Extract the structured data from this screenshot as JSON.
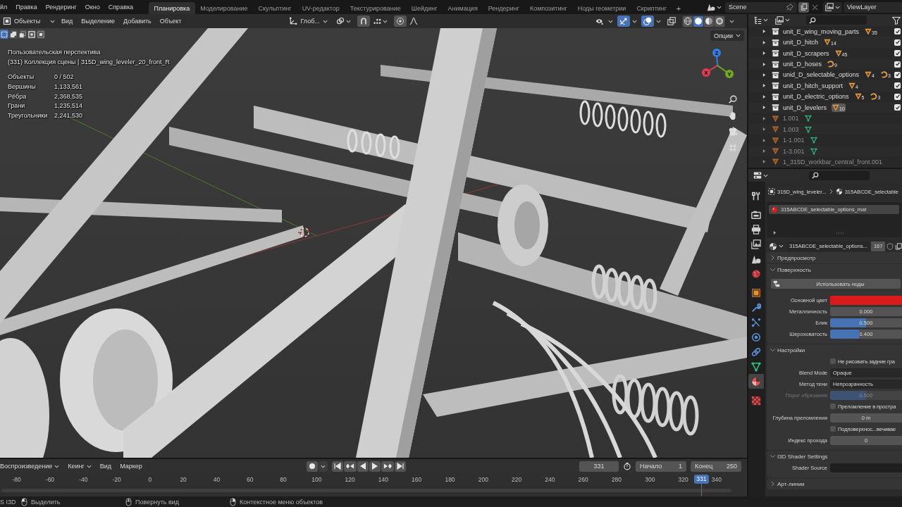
{
  "topbar": {
    "menus": [
      "йл",
      "Правка",
      "Рендеринг",
      "Окно",
      "Справка"
    ],
    "workspaces": [
      {
        "label": "Планировка",
        "selected": true
      },
      {
        "label": "Моделирование",
        "selected": false
      },
      {
        "label": "Скульптинг",
        "selected": false
      },
      {
        "label": "UV-редактор",
        "selected": false
      },
      {
        "label": "Текстурирование",
        "selected": false
      },
      {
        "label": "Шейдинг",
        "selected": false
      },
      {
        "label": "Анимация",
        "selected": false
      },
      {
        "label": "Рендеринг",
        "selected": false
      },
      {
        "label": "Композитинг",
        "selected": false
      },
      {
        "label": "Ноды геометрии",
        "selected": false
      },
      {
        "label": "Скриптинг",
        "selected": false
      }
    ],
    "add_workspace": "+",
    "scene": "Scene",
    "view_layer": "ViewLayer"
  },
  "viewport": {
    "mode": "Объекты",
    "menus": [
      "Вид",
      "Выделение",
      "Добавить",
      "Объект"
    ],
    "orientation": "Глоб...",
    "select_modes": [
      {
        "selected": true
      },
      {
        "selected": false
      },
      {
        "selected": false
      },
      {
        "selected": false
      },
      {
        "selected": false
      }
    ],
    "toggles": [
      {
        "kind": "visibility",
        "on": false
      },
      {
        "kind": "gizmo",
        "on": true
      },
      {
        "kind": "overlay",
        "on": true
      },
      {
        "kind": "xray",
        "on": false
      }
    ],
    "shading": [
      {
        "kind": "wireframe",
        "selected": false
      },
      {
        "kind": "solid",
        "selected": true
      },
      {
        "kind": "material",
        "selected": false
      },
      {
        "kind": "rendered",
        "selected": false
      }
    ],
    "options": "Опции",
    "view_name": "Пользовательская перспектива",
    "context": "(331) Коллекция сцены | 315D_wing_leveler_20_front_R",
    "stats": [
      {
        "label": "Объекты",
        "value": "0 / 502"
      },
      {
        "label": "Вершины",
        "value": "1,133,561"
      },
      {
        "label": "Рёбра",
        "value": "2,368,535"
      },
      {
        "label": "Грани",
        "value": "1,235,514"
      },
      {
        "label": "Треугольники",
        "value": "2,241,530"
      }
    ],
    "gizmo": [
      {
        "axis": "Z",
        "color": "#2f7fe0"
      },
      {
        "axis": "X",
        "color": "#e23b52"
      },
      {
        "axis": "Y",
        "color": "#72a91f"
      }
    ]
  },
  "timeline": {
    "menus": [
      {
        "label": "Воспроизведение",
        "dropdown": true
      },
      {
        "label": "Кеинг",
        "dropdown": true
      },
      {
        "label": "Вид",
        "dropdown": false
      },
      {
        "label": "Маркер",
        "dropdown": false
      }
    ],
    "current_frame": "331",
    "start_label": "Начало",
    "start": "1",
    "end_label": "Конец",
    "end": "250",
    "ticks": [
      "-80",
      "-60",
      "-40",
      "-20",
      "0",
      "20",
      "40",
      "60",
      "80",
      "100",
      "120",
      "140",
      "160",
      "180",
      "200",
      "220",
      "240",
      "260",
      "280",
      "300",
      "320",
      "340"
    ],
    "playhead": {
      "frame": "331",
      "level": 0.939
    }
  },
  "outliner": {
    "rows": [
      {
        "kind": "collection",
        "name": "unit_E_wing_moving_parts",
        "checked": true,
        "badges": [
          {
            "kind": "mesh",
            "count": "35",
            "active": false
          }
        ]
      },
      {
        "kind": "collection",
        "name": "unit_D_hitch",
        "checked": true,
        "badges": [
          {
            "kind": "mesh",
            "count": "14",
            "active": false
          }
        ]
      },
      {
        "kind": "collection",
        "name": "unit_D_scrapers",
        "checked": true,
        "badges": [
          {
            "kind": "mesh",
            "count": "45",
            "active": false
          }
        ]
      },
      {
        "kind": "collection",
        "name": "unit_D_hoses",
        "checked": true,
        "badges": [
          {
            "kind": "curve",
            "count": "9",
            "active": false
          }
        ]
      },
      {
        "kind": "collection",
        "name": "unid_D_selectable_options",
        "checked": true,
        "badges": [
          {
            "kind": "mesh",
            "count": "4",
            "active": false
          },
          {
            "kind": "curve",
            "count": "3",
            "active": false
          }
        ]
      },
      {
        "kind": "collection",
        "name": "unit_D_hitch_support",
        "checked": true,
        "badges": [
          {
            "kind": "mesh",
            "count": "4",
            "active": false
          }
        ]
      },
      {
        "kind": "collection",
        "name": "unit_D_electric_options",
        "checked": true,
        "badges": [
          {
            "kind": "mesh",
            "count": "5",
            "active": false
          },
          {
            "kind": "curve",
            "count": "3",
            "active": false
          }
        ]
      },
      {
        "kind": "collection",
        "name": "unit_D_levelers",
        "checked": true,
        "badges": [
          {
            "kind": "mesh",
            "count": "10",
            "active": true
          }
        ]
      },
      {
        "kind": "object",
        "name": "1.001",
        "badges": [
          {
            "kind": "mesh_data",
            "active": false
          }
        ]
      },
      {
        "kind": "object",
        "name": "1.003",
        "badges": [
          {
            "kind": "mesh_data",
            "active": false
          }
        ]
      },
      {
        "kind": "object",
        "name": "1-1.001",
        "badges": [
          {
            "kind": "mesh_data",
            "active": false
          }
        ]
      },
      {
        "kind": "object",
        "name": "1-3.001",
        "badges": [
          {
            "kind": "mesh_data",
            "active": false
          }
        ]
      },
      {
        "kind": "object",
        "name": "1_315D_workbar_central_front.001"
      }
    ]
  },
  "properties": {
    "tabs": [
      {
        "kind": "tool",
        "selected": false
      },
      {
        "kind": "render",
        "selected": false
      },
      {
        "kind": "output",
        "selected": false
      },
      {
        "kind": "view_layer",
        "selected": false
      },
      {
        "kind": "scene",
        "selected": false
      },
      {
        "kind": "world",
        "selected": false
      },
      {
        "kind": "object",
        "selected": false
      },
      {
        "kind": "modifiers",
        "selected": false
      },
      {
        "kind": "particles",
        "selected": false
      },
      {
        "kind": "physics",
        "selected": false
      },
      {
        "kind": "constraints",
        "selected": false
      },
      {
        "kind": "data",
        "selected": false
      },
      {
        "kind": "material",
        "selected": true
      },
      {
        "kind": "texture",
        "selected": false
      }
    ],
    "breadcrumb": [
      "315D_wing_leveler...",
      "315ABCDE_selectable"
    ],
    "slots": [
      {
        "name": "315ABCDE_selectable_options_mat",
        "selected": true
      }
    ],
    "material": {
      "name": "315ABCDE_selectable_options...",
      "users": "167"
    },
    "panels": [
      {
        "title": "Предпросмотр",
        "expanded": false
      },
      {
        "title": "Поверхность",
        "expanded": true,
        "rows": [
          {
            "kind": "button",
            "label": "Использовать ноды"
          },
          {
            "kind": "color",
            "label": "Основной цвет",
            "color": "#d81c1c"
          },
          {
            "kind": "slider",
            "label": "Металличность",
            "value": "0.000",
            "disabled": false
          },
          {
            "kind": "slider",
            "label": "Блик",
            "value": "0.500",
            "level": 0.5,
            "disabled": false
          },
          {
            "kind": "slider",
            "label": "Шероховатость",
            "value": "0.400",
            "level": 0.4,
            "disabled": false
          }
        ]
      },
      {
        "title": "Настройки",
        "expanded": true,
        "rows": [
          {
            "kind": "checkbox",
            "label": "Не рисовать задние гра",
            "checked": false
          },
          {
            "kind": "dropdown",
            "label": "Blend Mode",
            "value": "Opaque"
          },
          {
            "kind": "dropdown",
            "label": "Метод тени",
            "value": "Непрозрачность"
          },
          {
            "kind": "slider",
            "label": "Порог обрезания",
            "value": "0.500",
            "level": 0.5,
            "disabled": true
          },
          {
            "kind": "checkbox",
            "label": "Преломление в простра",
            "checked": false
          },
          {
            "kind": "number",
            "label": "Глубина преломления",
            "value": "0 m"
          },
          {
            "kind": "checkbox",
            "label": "Подповерхнос...вечивае",
            "checked": false
          },
          {
            "kind": "number",
            "label": "Индекс прохода",
            "value": "0"
          }
        ]
      },
      {
        "title": "I3D Shader Settings",
        "expanded": true,
        "rows": [
          {
            "kind": "text",
            "label": "Shader Source"
          }
        ]
      },
      {
        "title": "Арт-линии",
        "expanded": false
      }
    ]
  },
  "status_bar": {
    "context": "S I3D",
    "hints": [
      {
        "kind": "left",
        "label": "Выделить"
      },
      {
        "kind": "middle",
        "label": "Повернуть вид"
      },
      {
        "kind": "right",
        "label": "Контекстное меню объектов"
      }
    ]
  }
}
